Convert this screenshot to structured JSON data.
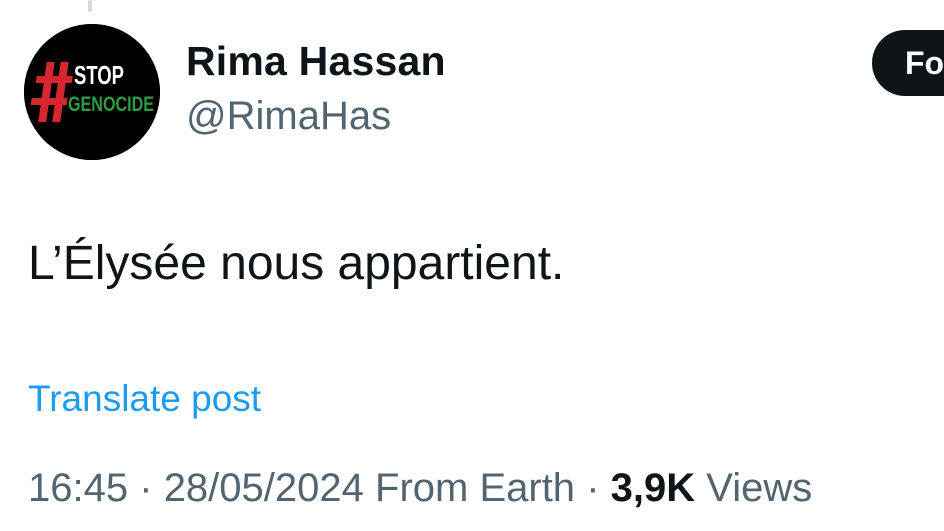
{
  "avatar": {
    "top_text": "STOP",
    "bottom_text": "GENOCIDE",
    "hash_symbol": "#",
    "colors": {
      "background": "#000000",
      "red": "#d6262f",
      "green": "#2e9b45",
      "white": "#ffffff"
    }
  },
  "author": {
    "display_name": "Rima Hassan",
    "handle": "@RimaHas"
  },
  "follow_button": {
    "label": "Fo"
  },
  "post": {
    "text": "L’Élysée nous appartient.",
    "translate_label": "Translate post"
  },
  "meta": {
    "time": "16:45",
    "date": "28/05/2024",
    "source": "From Earth",
    "separator": "·",
    "views_count": "3,9K",
    "views_label": "Views"
  },
  "colors": {
    "text_primary": "#0f1419",
    "text_secondary": "#536471",
    "link": "#1d9bf0"
  }
}
